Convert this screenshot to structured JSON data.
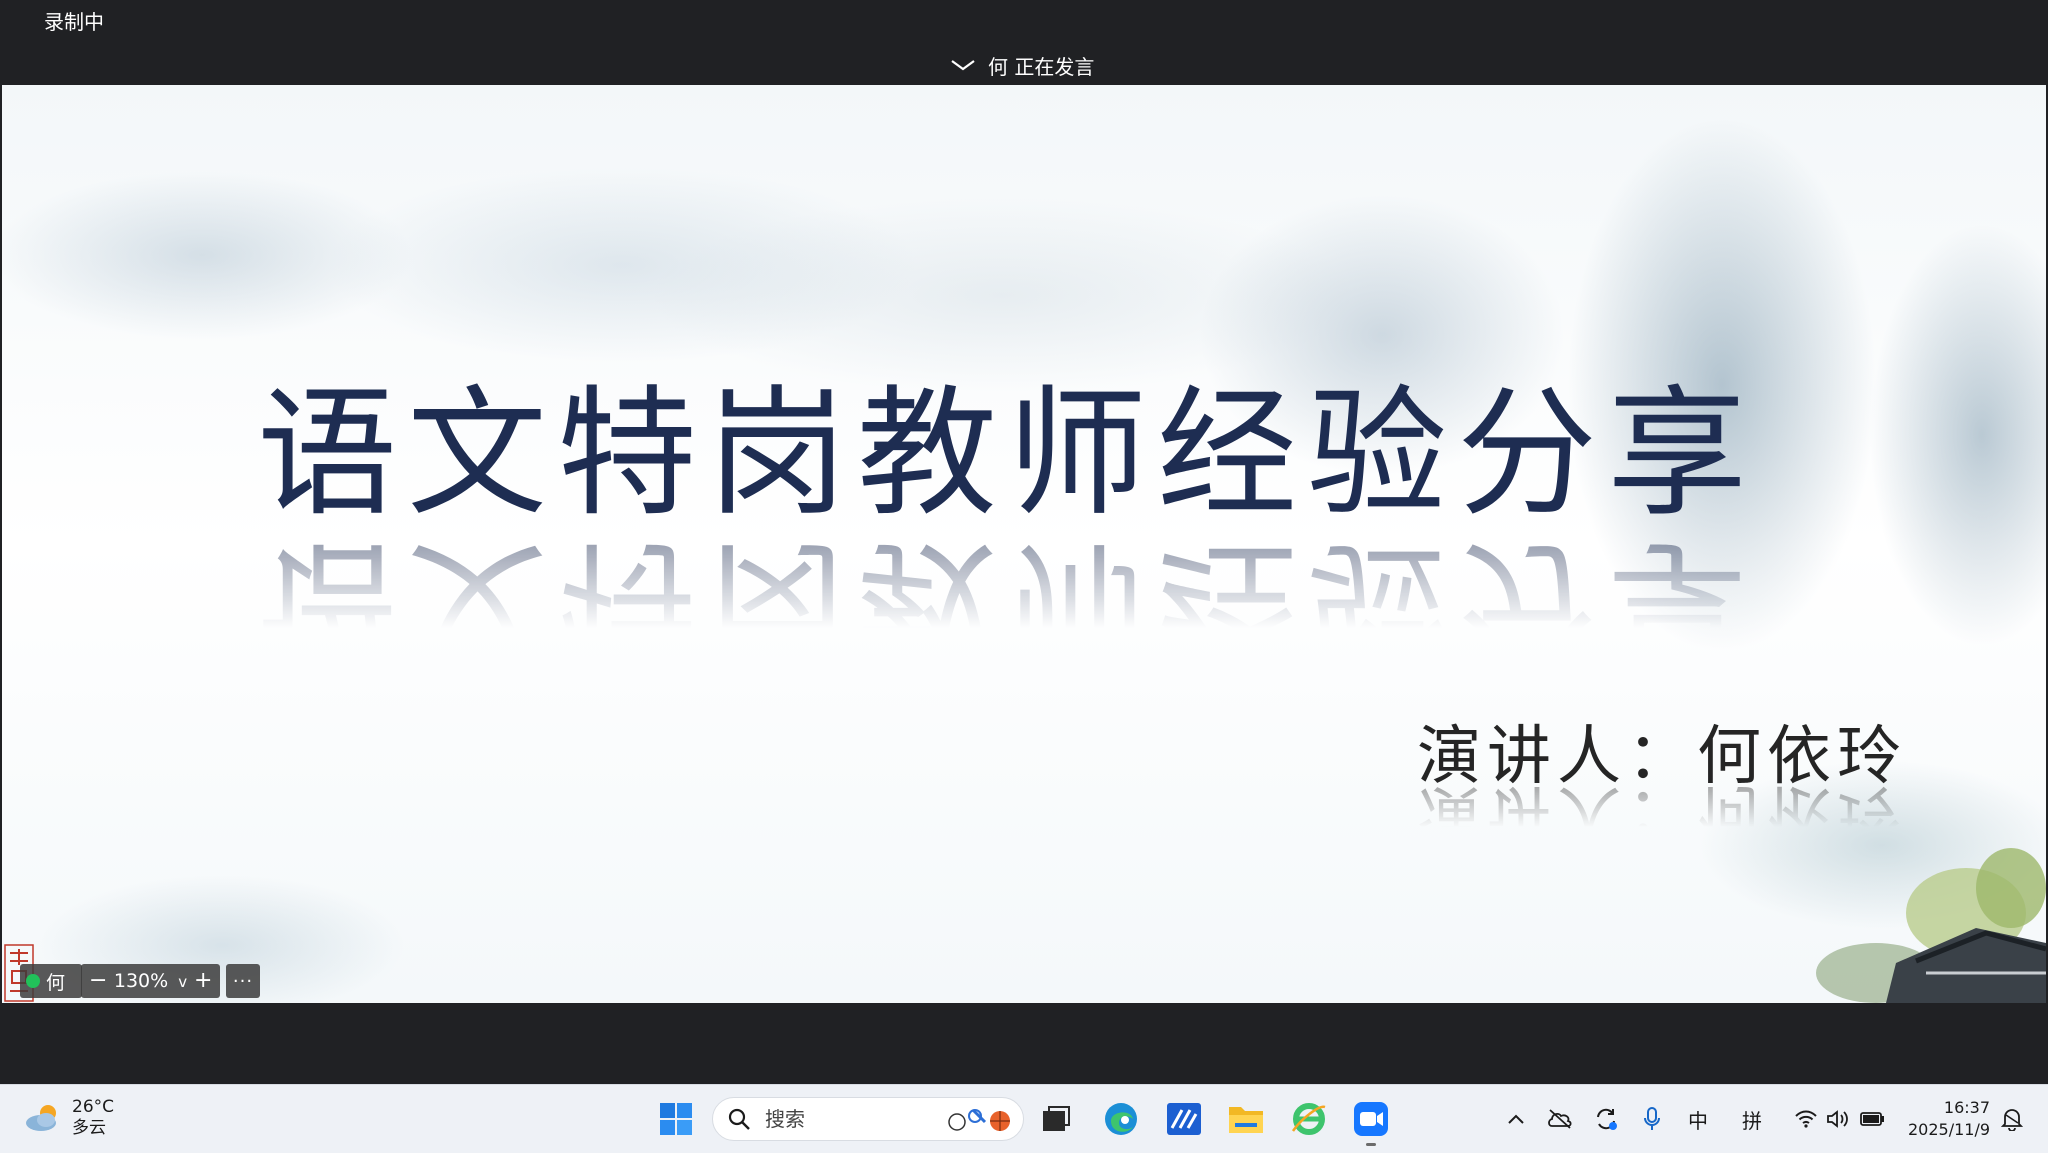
{
  "window": {
    "recording_label": "录制中",
    "speaker_status": "何 正在发言"
  },
  "slide": {
    "title": "语文特岗教师经验分享",
    "speaker_line": "演讲人：何依玲",
    "title_color": "#1e2d52"
  },
  "video_controls": {
    "participant_name": "何",
    "zoom_minus": "−",
    "zoom_level": "130%",
    "zoom_dropdown": "v",
    "zoom_plus": "+",
    "more": "···"
  },
  "taskbar": {
    "weather": {
      "temperature": "26°C",
      "condition": "多云",
      "icon": "cloud-sun-icon"
    },
    "search": {
      "placeholder": "搜索"
    },
    "pinned_apps": [
      "windows-start-icon",
      "task-view-icon",
      "edge-icon",
      "whiteboard-app-icon",
      "file-explorer-icon",
      "ie-browser-icon",
      "meeting-app-icon"
    ],
    "tray": {
      "ime_mode": "中",
      "ime_layout": "拼"
    },
    "clock": {
      "time": "16:37",
      "date": "2025/11/9"
    }
  },
  "colors": {
    "top_bar": "#202124",
    "taskbar": "#eef1f6",
    "accent_green": "#21c15a",
    "meeting_blue": "#1677ff"
  }
}
